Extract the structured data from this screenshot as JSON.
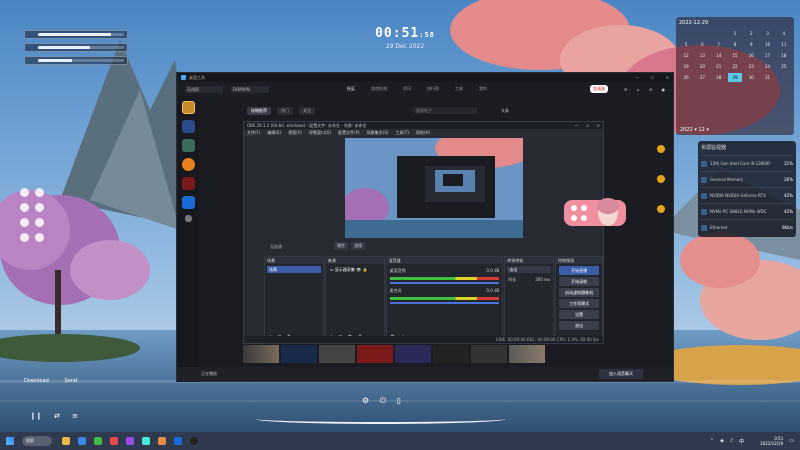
{
  "desktop": {
    "clock_time": "00:51",
    "clock_seconds": "58",
    "clock_date": "29 Dec 2022",
    "media": {
      "download_label": "Download",
      "send_label": "Send"
    },
    "hw_bars": [
      {
        "label": "",
        "level": 0.85
      },
      {
        "label": "",
        "level": 0.6
      },
      {
        "label": "",
        "level": 0.4
      }
    ]
  },
  "calendar": {
    "header": "2022-12-29",
    "year_month": "2022 ▾   12 ▾",
    "days": [
      "",
      "",
      "",
      "1",
      "2",
      "3",
      "4",
      "5",
      "6",
      "7",
      "8",
      "9",
      "10",
      "11",
      "12",
      "13",
      "14",
      "15",
      "16",
      "17",
      "18",
      "19",
      "20",
      "21",
      "22",
      "23",
      "24",
      "25",
      "26",
      "27",
      "28",
      "29",
      "30",
      "31",
      "",
      "",
      "",
      "",
      "",
      "",
      "",
      ""
    ],
    "today": "29"
  },
  "resource_monitor": {
    "title": "资源监视器",
    "rows": [
      {
        "name": "13th Gen Intel Core i9-13900F",
        "pct": "21%"
      },
      {
        "name": "General Memory",
        "pct": "26%"
      },
      {
        "name": "NVIDIA NVIDIA GeForce RTX",
        "pct": "42%"
      },
      {
        "name": "NVMe PC SN810 NVMe WDC",
        "pct": "42%"
      },
      {
        "name": "Ethernet",
        "pct": "0Kb/s"
      }
    ]
  },
  "app": {
    "window_title": "桌面工具",
    "nav_select_1": "无线网",
    "nav_select_2": "DOMAIN",
    "tabs": [
      "社区",
      "游戏检测",
      "资讯",
      "排行榜",
      "工具",
      "我的"
    ],
    "active_tab": "社区",
    "badge": "加速器",
    "sub_tabs": [
      "攻略推荐",
      "热门",
      "关注"
    ],
    "search_placeholder": "搜索帖子",
    "search_label": "头条",
    "left_texts": [
      "要闻的，",
      "发帖",
      "搜索不到",
      "《魔兽世"
    ],
    "footer_text": "正在播放",
    "play_button": "加入语音聊天"
  },
  "obs": {
    "title": "OBS 29.1.2 (64-bit, windows) - 配置文件: 未命名 - 场景: 未命名",
    "menu": [
      "文件(F)",
      "编辑(E)",
      "视图(V)",
      "停靠窗口(D)",
      "配置文件(P)",
      "场景集合(S)",
      "工具(T)",
      "帮助(H)"
    ],
    "source_label": "无选源",
    "btn_properties": "属性",
    "btn_filters": "滤镜",
    "docks": {
      "scenes": {
        "title": "场景",
        "items": [
          "场景"
        ]
      },
      "sources": {
        "title": "来源",
        "items": [
          "显示器采集"
        ]
      },
      "mixer": {
        "title": "混音器",
        "channels": [
          {
            "name": "桌面音频",
            "db": "0.0 dB"
          },
          {
            "name": "麦克风",
            "db": "0.0 dB"
          }
        ]
      },
      "transitions": {
        "title": "转场特效",
        "type": "淡出",
        "duration_label": "时长",
        "duration": "300 ms"
      },
      "controls": {
        "title": "控制按钮",
        "buttons": [
          "开始直播",
          "开始录制",
          "启动虚拟摄像机",
          "工作室模式",
          "设置",
          "退出"
        ]
      }
    },
    "status": "LIVE: 00:00:00   REC: 00:00:00   CPU: 1.4%, 60.00 fps"
  },
  "taskbar": {
    "search_label": "搜索",
    "time": "0:51",
    "date": "2022/12/29"
  },
  "colors": {
    "accent": "#3b5ca8",
    "app_bg": "#1b1c22",
    "obs_bg": "#272a33"
  }
}
